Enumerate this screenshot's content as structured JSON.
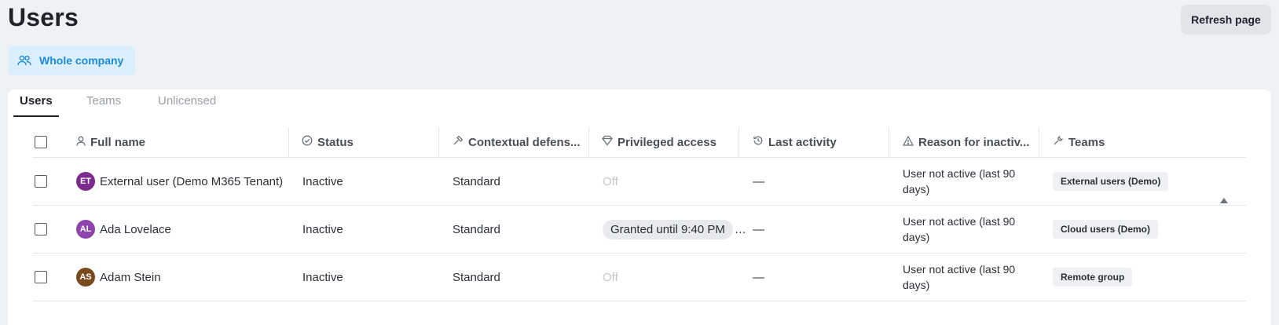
{
  "page": {
    "title": "Users",
    "refresh_label": "Refresh page",
    "scope_label": "Whole company"
  },
  "tabs": [
    {
      "label": "Users"
    },
    {
      "label": "Teams"
    },
    {
      "label": "Unlicensed"
    }
  ],
  "columns": [
    {
      "label": "Full name",
      "icon": "user-icon"
    },
    {
      "label": "Status",
      "icon": "check-circle-icon"
    },
    {
      "label": "Contextual defens...",
      "icon": "hammer-icon"
    },
    {
      "label": "Privileged access",
      "icon": "diamond-shield-icon"
    },
    {
      "label": "Last activity",
      "icon": "history-icon"
    },
    {
      "label": "Reason for inactiv...",
      "icon": "warning-icon"
    },
    {
      "label": "Teams",
      "icon": "wrench-icon"
    }
  ],
  "rows": [
    {
      "initials": "ET",
      "avatar_color": "#7b2a8e",
      "name": "External user (Demo M365 Tenant)",
      "status": "Inactive",
      "defense": "Standard",
      "privileged": "Off",
      "last_activity": "—",
      "reason": "User not active (last 90 days)",
      "team": "External users (Demo)"
    },
    {
      "initials": "AL",
      "avatar_color": "#8e44ad",
      "name": "Ada Lovelace",
      "status": "Inactive",
      "defense": "Standard",
      "privileged": "Granted until 9:40 PM",
      "last_activity": "—",
      "reason": "User not active (last 90 days)",
      "team": "Cloud users (Demo)"
    },
    {
      "initials": "AS",
      "avatar_color": "#7a4a1f",
      "name": "Adam Stein",
      "status": "Inactive",
      "defense": "Standard",
      "privileged": "Off",
      "last_activity": "—",
      "reason": "User not active (last 90 days)",
      "team": "Remote group"
    }
  ]
}
